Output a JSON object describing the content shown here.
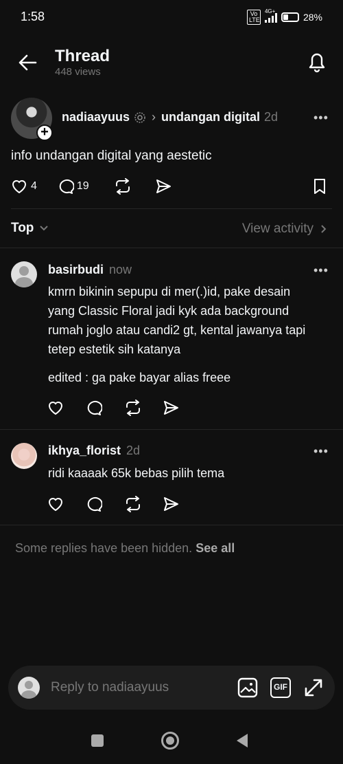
{
  "status_bar": {
    "time": "1:58",
    "network": "4G+",
    "volte": "Vo LTE",
    "battery": "28%"
  },
  "header": {
    "title": "Thread",
    "views": "448 views",
    "back_icon": "arrow-left-icon",
    "bell_icon": "bell-icon"
  },
  "post": {
    "author": "nadiaayuus",
    "topic": "undangan digital",
    "time": "2d",
    "text": "info undangan digital yang aestetic",
    "likes": "4",
    "replies": "19"
  },
  "sort": {
    "label": "Top",
    "activity": "View activity"
  },
  "replies": [
    {
      "author": "basirbudi",
      "time": "now",
      "lines": [
        "kmrn bikinin sepupu di mer(.)id, pake desain",
        "yang Classic Floral jadi kyk ada background",
        "rumah joglo atau candi2 gt, kental jawanya tapi",
        "tetep estetik sih katanya"
      ],
      "edited": "edited : ga pake bayar alias freee"
    },
    {
      "author": "ikhya_florist",
      "time": "2d",
      "lines": [
        "ridi kaaaak 65k bebas pilih tema"
      ]
    }
  ],
  "hidden": {
    "text": "Some replies have been hidden.",
    "link": "See all"
  },
  "composer": {
    "placeholder": "Reply to nadiaayuus",
    "gif_label": "GIF"
  },
  "more_label": "•••"
}
